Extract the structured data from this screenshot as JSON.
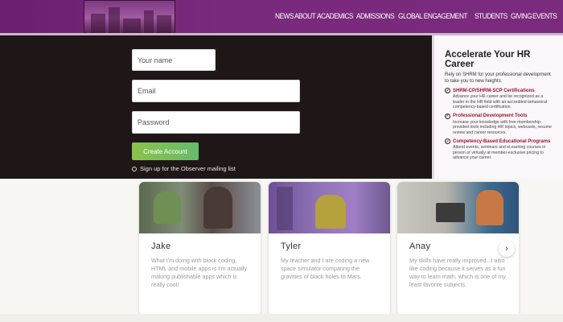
{
  "nav": {
    "links": [
      "NEWS",
      "ABOUT",
      "ACADEMICS",
      "ADMISSIONS",
      "GLOBAL ENGAGEMENT",
      "STUDENTS",
      "GIVING",
      "EVENTS"
    ]
  },
  "form": {
    "name_placeholder": "Your name",
    "email_placeholder": "Email",
    "password_placeholder": "Password",
    "create_label": "Create Account",
    "signup_label": "Sign up for the Observer mailing list"
  },
  "promo": {
    "title": "Accelerate Your HR Career",
    "intro": "Rely on SHRM for your professional development to take you to new heights.",
    "items": [
      {
        "heading": "SHRM-CP/SHRM-SCP Certifications",
        "desc": "Advance your HR career and be recognized as a leader in the HR field with an accredited behavioral competency-based certification."
      },
      {
        "heading": "Professional Development Tools",
        "desc": "Increase your knowledge with free membership-provided tools including HR topics, webcasts, resume review and career resources."
      },
      {
        "heading": "Competency-Based Educational Programs",
        "desc": "Attend events, seminars and eLearning courses in person or virtually at member-exclusive pricing to advance your career."
      }
    ]
  },
  "testimonials": [
    {
      "name": "Jake",
      "quote": "What I'm doing with block coding, HTML and mobile apps is I'm actually making publishable apps which is really cool!"
    },
    {
      "name": "Tyler",
      "quote": "My teacher and I are coding a new space simulator comparing the gravities of black holes to Mars."
    },
    {
      "name": "Anay",
      "quote": "My skills have really improved...I also like coding because it serves as a fun way to learn math, which is one of my least favorite subjects."
    }
  ],
  "carousel": {
    "next_glyph": "›"
  },
  "colors": {
    "nav_bg": "#7a2a7c",
    "dark_bg": "#1f1618",
    "accent_red": "#a0122d",
    "button_green": "#7cc35a"
  }
}
